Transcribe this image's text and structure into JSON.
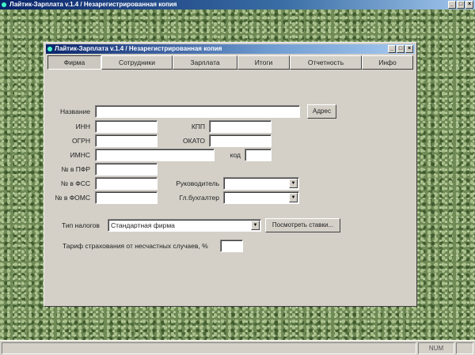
{
  "app": {
    "title": "Лайтик-Зарплата v.1.4 / Незарегистрированная копия",
    "controls": [
      "_",
      "□",
      "×"
    ]
  },
  "window": {
    "title": "Лайтик-Зарплата v.1.4 / Незарегистрированная копия",
    "controls": [
      "_",
      "□",
      "×"
    ]
  },
  "tabs": [
    "Фирма",
    "Сотрудники",
    "Зарплата",
    "Итоги",
    "Отчетность",
    "Инфо"
  ],
  "form": {
    "name_label": "Название",
    "address_button": "Адрес",
    "inn_label": "ИНН",
    "kpp_label": "КПП",
    "ogrn_label": "ОГРН",
    "okato_label": "ОКАТО",
    "imns_label": "ИМНС",
    "kod_label": "код",
    "pfr_label": "№ в ПФР",
    "fss_label": "№ в ФСС",
    "foms_label": "№ в ФОМС",
    "director_label": "Руководитель",
    "accountant_label": "Гл.бухгалтер",
    "tax_type_label": "Тип налогов",
    "tax_type_value": "Стандартная фирма",
    "view_rates_button": "Посмотреть ставки...",
    "insurance_label": "Тариф страхования от несчастных случаев, %"
  },
  "status": {
    "num": "NUM"
  }
}
